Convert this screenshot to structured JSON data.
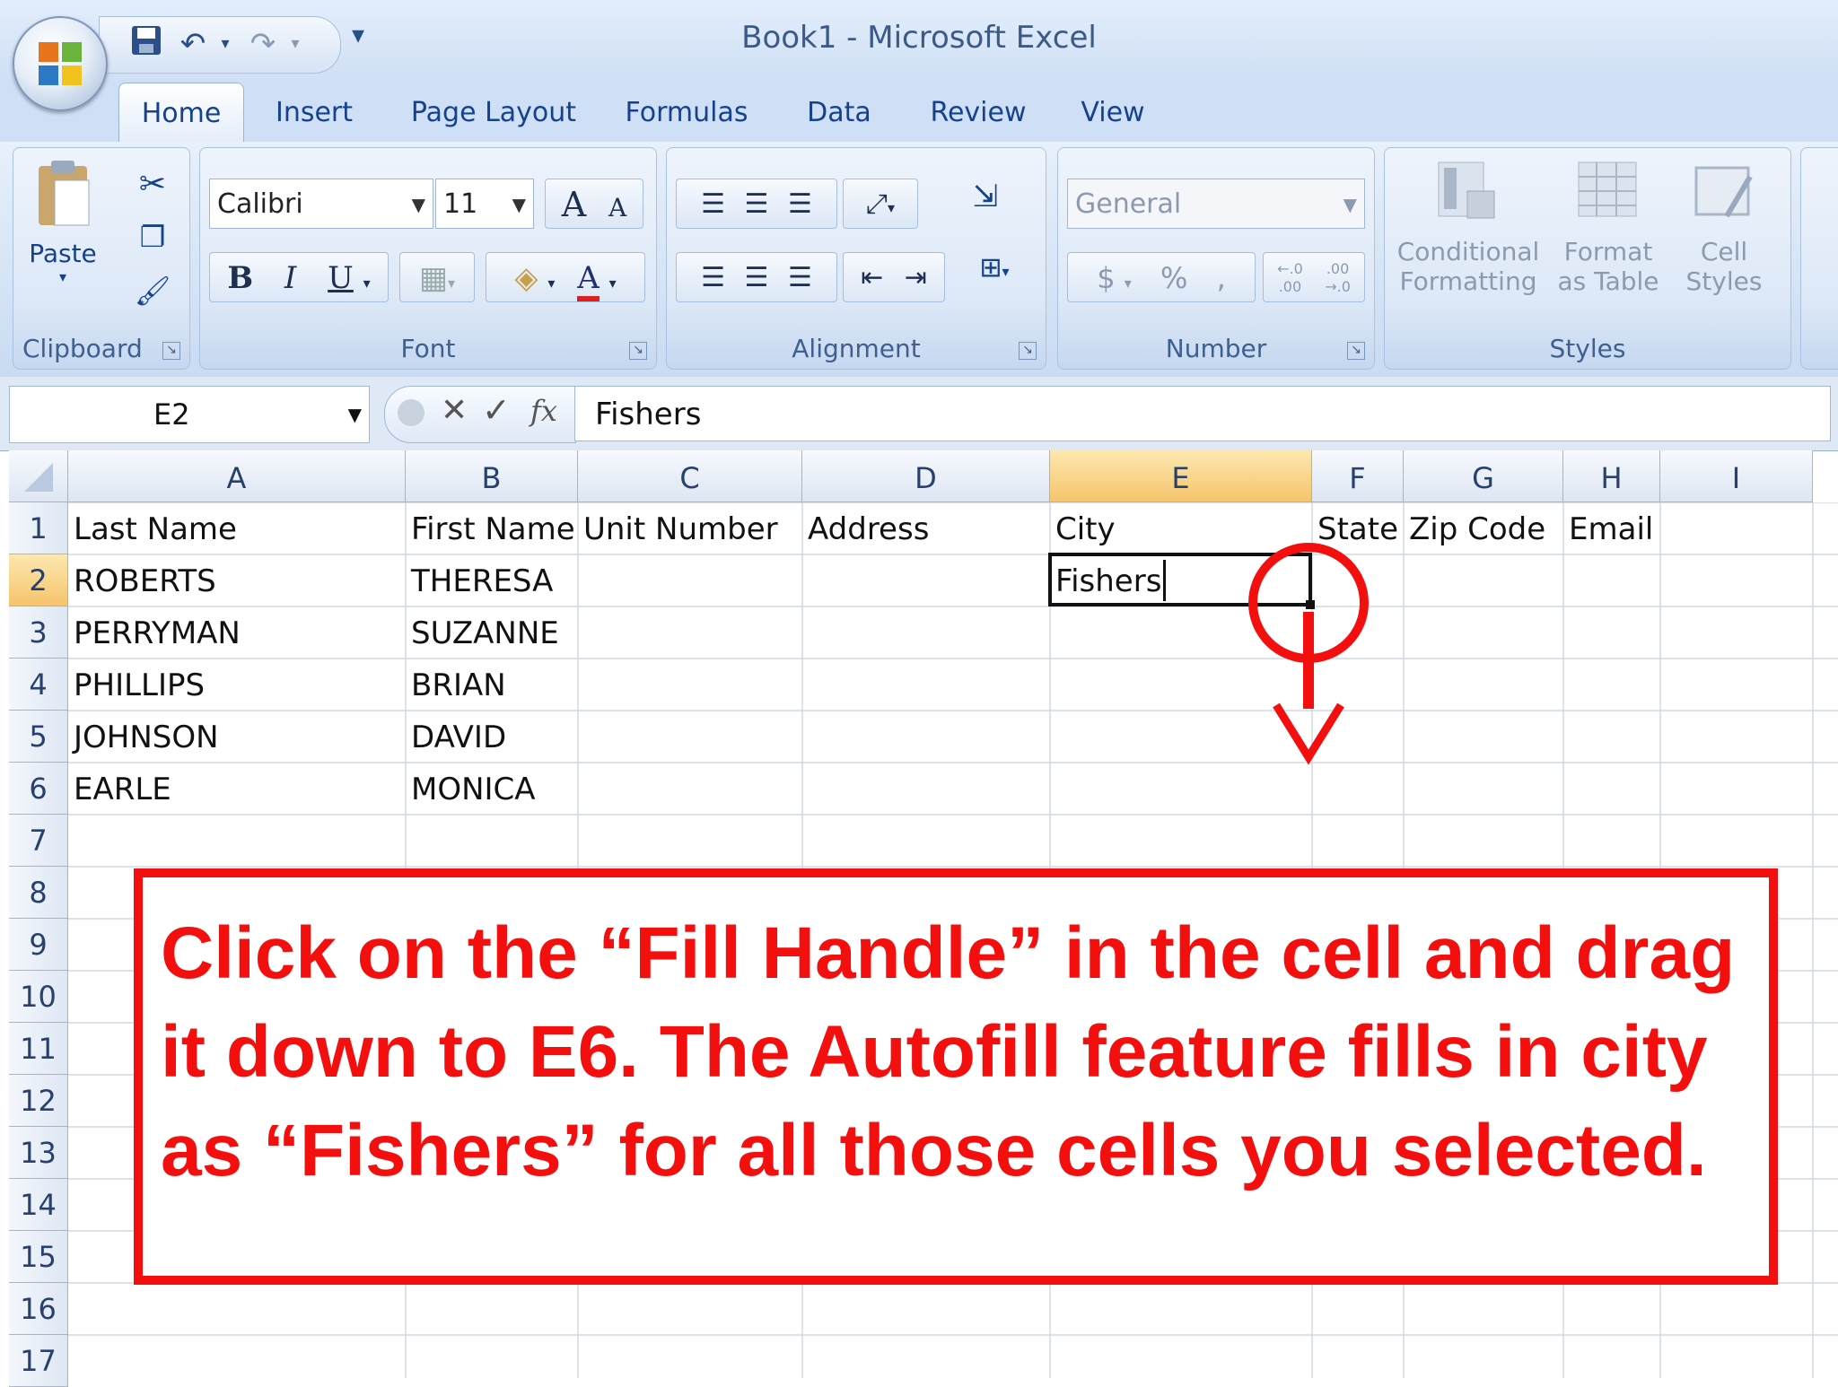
{
  "window": {
    "title": "Book1 - Microsoft Excel"
  },
  "qat": {
    "icons": [
      "save-icon",
      "undo-icon",
      "redo-icon",
      "customize-icon"
    ]
  },
  "tabs": [
    "Home",
    "Insert",
    "Page Layout",
    "Formulas",
    "Data",
    "Review",
    "View"
  ],
  "ribbon": {
    "clipboard": {
      "label": "Clipboard",
      "paste": "Paste"
    },
    "font": {
      "label": "Font",
      "font_name": "Calibri",
      "font_size": "11",
      "bold": "B",
      "italic": "I",
      "underline": "U",
      "grow": "A",
      "shrink": "A",
      "font_color": "A"
    },
    "alignment": {
      "label": "Alignment"
    },
    "number": {
      "label": "Number",
      "format": "General",
      "currency": "$",
      "percent": "%",
      "comma": ",",
      "inc_decimal": "←.0 .00",
      "dec_decimal": ".00 →.0"
    },
    "styles": {
      "label": "Styles",
      "conditional_1": "Conditional",
      "conditional_2": "Formatting",
      "format_1": "Format",
      "format_2": "as Table",
      "cell_1": "Cell",
      "cell_2": "Styles"
    }
  },
  "formula_bar": {
    "name_box": "E2",
    "value": "Fishers",
    "fx": "fx"
  },
  "columns": [
    "A",
    "B",
    "C",
    "D",
    "E",
    "F",
    "G",
    "H",
    "I"
  ],
  "rows": [
    "1",
    "2",
    "3",
    "4",
    "5",
    "6",
    "7",
    "8",
    "9",
    "10",
    "11",
    "12",
    "13",
    "14",
    "15",
    "16",
    "17"
  ],
  "headers": [
    "Last Name",
    "First Name",
    "Unit Number",
    "Address",
    "City",
    "State",
    "Zip Code",
    "Email"
  ],
  "data": [
    [
      "ROBERTS",
      "THERESA",
      "",
      "",
      "Fishers"
    ],
    [
      "PERRYMAN",
      "SUZANNE"
    ],
    [
      "PHILLIPS",
      "BRIAN"
    ],
    [
      "JOHNSON",
      "DAVID"
    ],
    [
      "EARLE",
      "MONICA"
    ]
  ],
  "active_cell": "E2",
  "annotation": {
    "text": "Click on the “Fill Handle” in the cell and drag it down to E6. The Autofill feature fills in city as “Fishers” for all those cells you selected.",
    "color": "#f40f0f"
  }
}
